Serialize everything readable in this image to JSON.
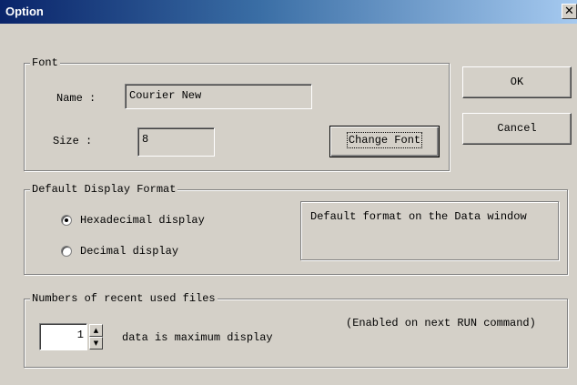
{
  "window": {
    "title": "Option",
    "close_glyph": "✕"
  },
  "font_group": {
    "legend": "Font",
    "name_label": "Name :",
    "name_value": "Courier New",
    "size_label": "Size :",
    "size_value": "8",
    "change_font_button": "Change Font"
  },
  "actions": {
    "ok": "OK",
    "cancel": "Cancel"
  },
  "display_group": {
    "legend": "Default Display Format",
    "options": [
      {
        "label": "Hexadecimal display",
        "selected": true
      },
      {
        "label": "Decimal display",
        "selected": false
      }
    ],
    "info": "Default format on the Data window"
  },
  "recent_group": {
    "legend": "Numbers of recent used files",
    "count": "1",
    "suffix": "data is maximum display",
    "note": "(Enabled on next RUN command)"
  },
  "icons": {
    "spin_up": "▲",
    "spin_down": "▼"
  }
}
